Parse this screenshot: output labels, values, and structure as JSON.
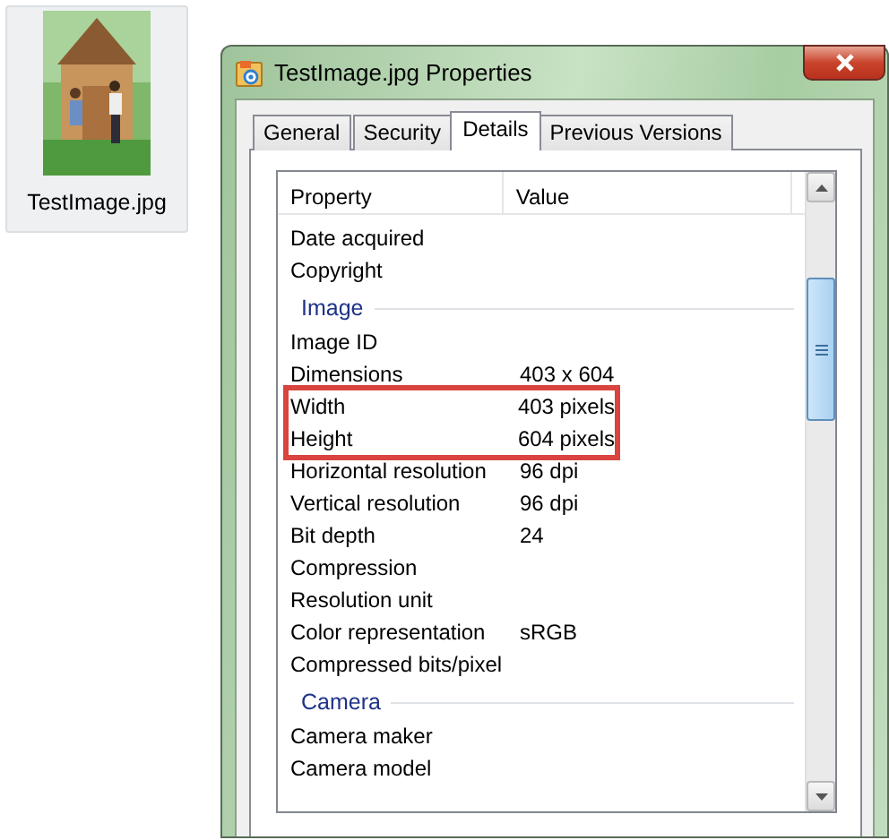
{
  "desktop_icon": {
    "label": "TestImage.jpg",
    "selected": true
  },
  "dialog": {
    "title": "TestImage.jpg Properties",
    "tabs": [
      {
        "label": "General",
        "selected": false
      },
      {
        "label": "Security",
        "selected": false
      },
      {
        "label": "Details",
        "selected": true
      },
      {
        "label": "Previous Versions",
        "selected": false
      }
    ],
    "list": {
      "columns": [
        "Property",
        "Value"
      ],
      "rows": [
        {
          "kind": "property",
          "property": "Date acquired",
          "highlighted": false
        },
        {
          "kind": "property",
          "property": "Copyright",
          "highlighted": false
        },
        {
          "kind": "group",
          "property": "Image"
        },
        {
          "kind": "property",
          "property": "Image ID",
          "highlighted": false
        },
        {
          "kind": "property",
          "property": "Dimensions",
          "value": "403 x 604",
          "highlighted": false
        },
        {
          "kind": "property",
          "property": "Width",
          "value": "403 pixels",
          "highlighted": true
        },
        {
          "kind": "property",
          "property": "Height",
          "value": "604 pixels",
          "highlighted": true
        },
        {
          "kind": "property",
          "property": "Horizontal resolution",
          "value": "96 dpi",
          "highlighted": false
        },
        {
          "kind": "property",
          "property": "Vertical resolution",
          "value": "96 dpi",
          "highlighted": false
        },
        {
          "kind": "property",
          "property": "Bit depth",
          "value": "24",
          "highlighted": false
        },
        {
          "kind": "property",
          "property": "Compression",
          "highlighted": false
        },
        {
          "kind": "property",
          "property": "Resolution unit",
          "highlighted": false
        },
        {
          "kind": "property",
          "property": "Color representation",
          "value": "sRGB",
          "highlighted": false
        },
        {
          "kind": "property",
          "property": "Compressed bits/pixel",
          "highlighted": false
        },
        {
          "kind": "group",
          "property": "Camera"
        },
        {
          "kind": "property",
          "property": "Camera maker",
          "highlighted": false
        },
        {
          "kind": "property",
          "property": "Camera model",
          "highlighted": false
        }
      ]
    }
  }
}
